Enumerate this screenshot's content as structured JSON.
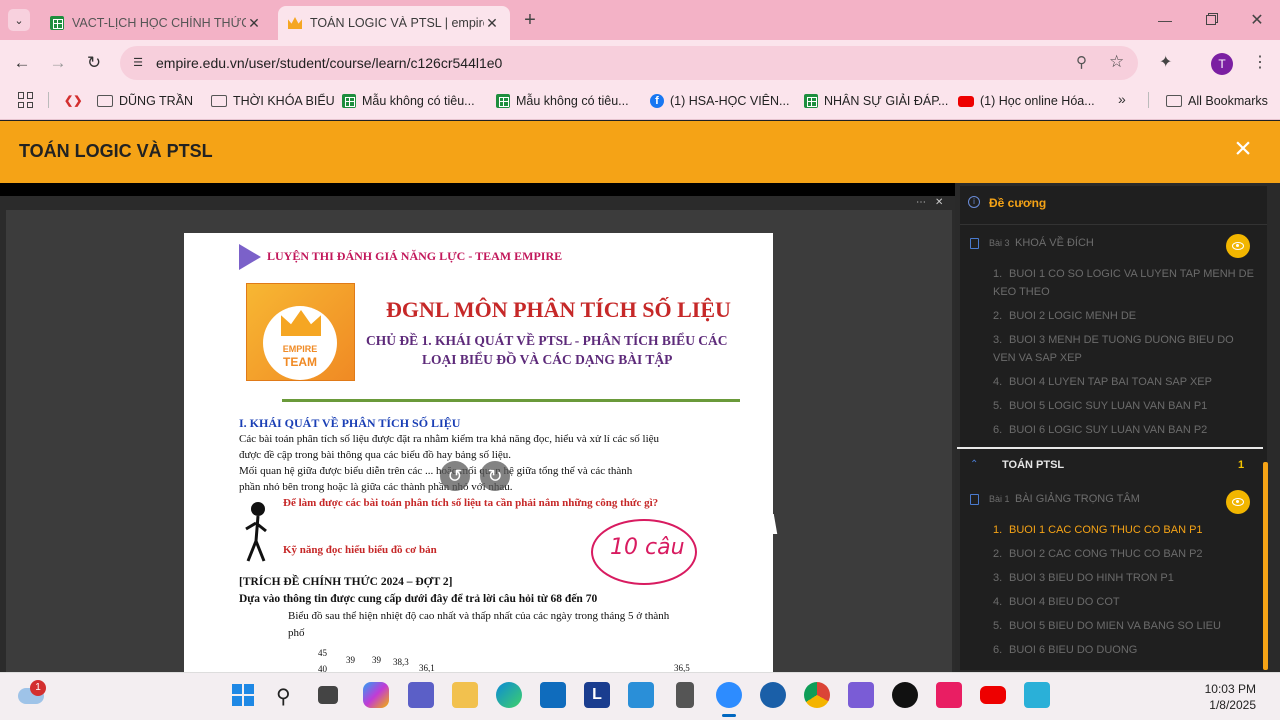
{
  "browser": {
    "tabs": [
      {
        "title": "VACT-LỊCH HỌC CHÍNH THỨC",
        "icon": "sheets-icon"
      },
      {
        "title": "TOÁN LOGIC VÀ PTSL | empire",
        "icon": "crown-icon"
      }
    ],
    "url": "empire.edu.vn/user/student/course/learn/c126cr544l1e0",
    "bookmarks": [
      {
        "label": "DŨNG TRẦN",
        "icon": "folder-icon"
      },
      {
        "label": "THỜI KHÓA BIỂU",
        "icon": "folder-icon"
      },
      {
        "label": "Mẫu không có tiêu...",
        "icon": "sheets-icon"
      },
      {
        "label": "Mẫu không có tiêu...",
        "icon": "sheets-icon"
      },
      {
        "label": "(1) HSA-HỌC VIÊN...",
        "icon": "facebook-icon"
      },
      {
        "label": "NHÂN SỰ GIẢI ĐÁP...",
        "icon": "sheets-icon"
      },
      {
        "label": "(1) Học online Hóa...",
        "icon": "youtube-icon"
      }
    ],
    "all_bookmarks": "All Bookmarks",
    "profile_initial": "T"
  },
  "course": {
    "title": "TOÁN LOGIC VÀ PTSL"
  },
  "document": {
    "banner": "LUYỆN THI ĐÁNH GIÁ NĂNG LỰC - TEAM EMPIRE",
    "logo_line1": "EMPIRE",
    "logo_line2": "TEAM",
    "main_title": "ĐGNL MÔN PHÂN TÍCH SỐ LIỆU",
    "subtitle1": "CHỦ ĐỀ 1. KHÁI QUÁT VỀ PTSL - PHÂN TÍCH BIỂU CÁC",
    "subtitle2": "LOẠI BIỂU ĐỒ VÀ CÁC DẠNG BÀI TẬP",
    "section": "I. KHÁI QUÁT VỀ PHÂN TÍCH SỐ LIỆU",
    "p1": "Các bài toán phân tích số liệu được đặt ra nhằm kiểm tra khả năng đọc, hiểu và xử lí các số liệu",
    "p2": "được đề cập trong bài thông qua các biểu đồ hay bảng số liệu.",
    "p3": "Mối quan hệ giữa được biểu diễn trên các ... hoặc mối quan hệ giữa tổng thể và các thành",
    "p4": "phần nhỏ bên trong hoặc là giữa các thành phần nhỏ với nhau.",
    "question": "Để làm được các bài toán phân tích số liệu ta cần phải nắm những công thức gì?",
    "skill": "Kỹ năng đọc hiểu biểu đồ cơ bản",
    "handwritten": "10 câu",
    "exam": "[TRÍCH ĐỀ CHÍNH THỨC 2024 – ĐỢT 2]",
    "instruction": "Dựa vào thông tin được cung cấp dưới đây để trả lời câu hỏi từ 68 đến 70",
    "chart_desc1": "Biểu đồ sau thể hiện nhiệt độ cao nhất và thấp nhất của các ngày trong tháng 5 ở thành",
    "chart_desc2": "phố",
    "chart_labels": [
      "45",
      "40",
      "39",
      "39",
      "38,3",
      "36,1",
      "36,5"
    ]
  },
  "sidebar": {
    "heading": "Đề cương",
    "section1": {
      "tag": "Bài 3",
      "title": "KHOÁ VỀ ĐÍCH",
      "lessons": [
        {
          "n": "1.",
          "title": "BUOI 1 CO SO LOGIC VA LUYEN TAP MENH DE KEO THEO"
        },
        {
          "n": "2.",
          "title": "BUOI 2 LOGIC MENH DE"
        },
        {
          "n": "3.",
          "title": "BUOI 3 MENH DE TUONG DUONG BIEU DO VEN VA SAP XEP"
        },
        {
          "n": "4.",
          "title": "BUOI 4 LUYEN TAP BAI TOAN SAP XEP"
        },
        {
          "n": "5.",
          "title": "BUOI 5 LOGIC SUY LUAN VAN BAN P1"
        },
        {
          "n": "6.",
          "title": "BUOI 6 LOGIC SUY LUAN VAN BAN P2"
        }
      ]
    },
    "group": {
      "title": "TOÁN PTSL",
      "count": "1"
    },
    "section2": {
      "tag": "Bài 1",
      "title": "BÀI GIẢNG TRỌNG TÂM",
      "lessons": [
        {
          "n": "1.",
          "title": "BUOI 1 CAC CONG THUC CO BAN P1",
          "active": true
        },
        {
          "n": "2.",
          "title": "BUOI 2 CAC CONG THUC CO BAN P2"
        },
        {
          "n": "3.",
          "title": "BUOI 3 BIEU DO HINH TRON P1"
        },
        {
          "n": "4.",
          "title": "BUOI 4 BIEU DO COT"
        },
        {
          "n": "5.",
          "title": "BUOI 5 BIEU DO MIEN VA BANG SO LIEU"
        },
        {
          "n": "6.",
          "title": "BUOI 6 BIEU DO DUONG"
        }
      ]
    }
  },
  "taskbar": {
    "time": "10:03 PM",
    "date": "1/8/2025",
    "badge": "1"
  }
}
